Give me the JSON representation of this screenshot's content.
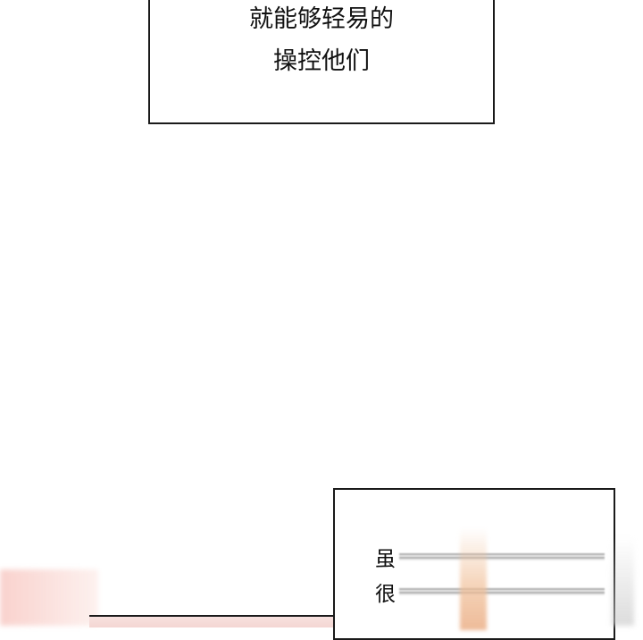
{
  "captions": {
    "top": {
      "line1": "就能够轻易的",
      "line2": "操控他们"
    },
    "bottom": {
      "line1_visible": "虽",
      "line2_visible": "很"
    }
  },
  "colors": {
    "border": "#1a1a1a",
    "background": "#ffffff",
    "art_pink": "#f8cdc8",
    "art_peach": "#f0be96"
  }
}
